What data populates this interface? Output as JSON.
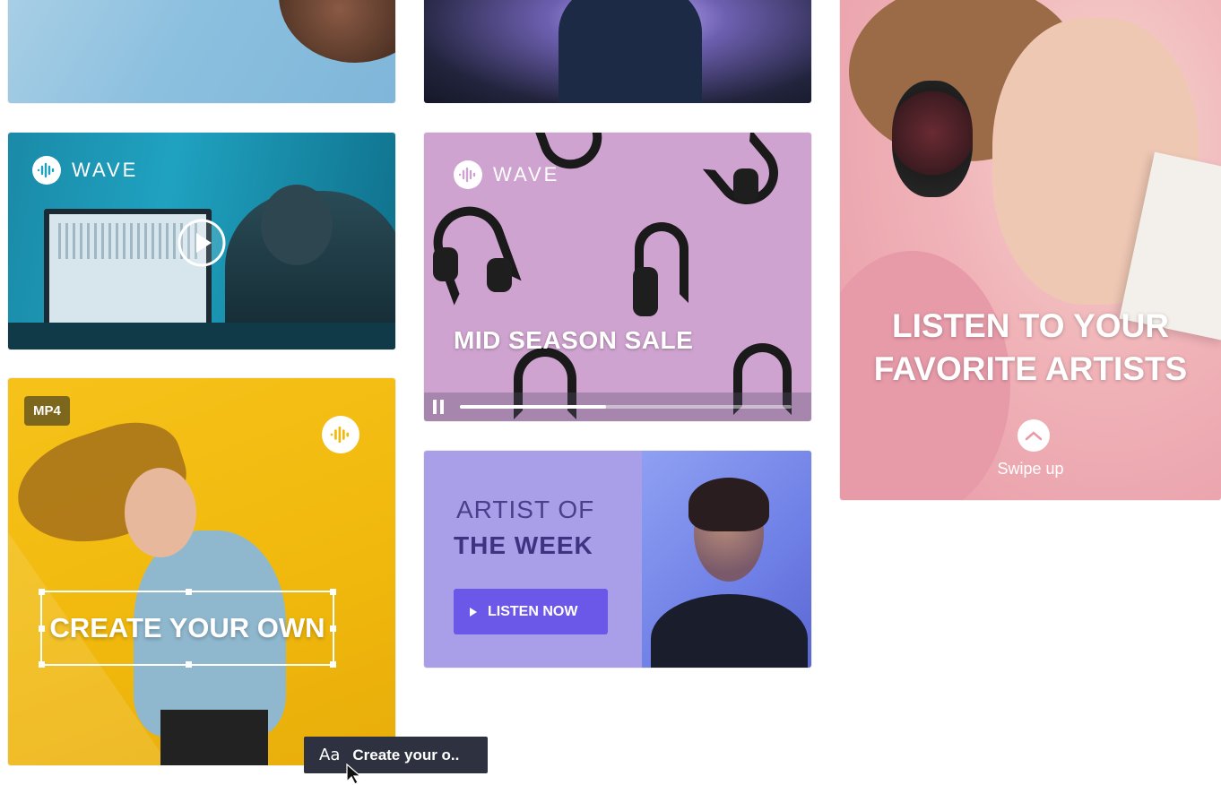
{
  "cards": {
    "studio": {
      "brand": "WAVE"
    },
    "sale": {
      "brand": "WAVE",
      "title": "MID SEASON SALE",
      "progress": 0.44
    },
    "create": {
      "format_badge": "MP4",
      "text": "CREATE YOUR OWN"
    },
    "artist": {
      "line1": "ARTIST OF",
      "line2": "THE WEEK",
      "button_label": "LISTEN NOW"
    },
    "story": {
      "title_line1": "LISTEN TO YOUR",
      "title_line2": "FAVORITE ARTISTS",
      "swipe_label": "Swipe up"
    }
  },
  "tooltip": {
    "icon_text": "Aa",
    "text": "Create your o.."
  },
  "colors": {
    "accent_button": "#6b57e8",
    "create_bg": "#f1b90d",
    "sale_bg": "#cfa3cf",
    "artist_bg": "#a89fe8",
    "tooltip_bg": "#2e3140"
  }
}
